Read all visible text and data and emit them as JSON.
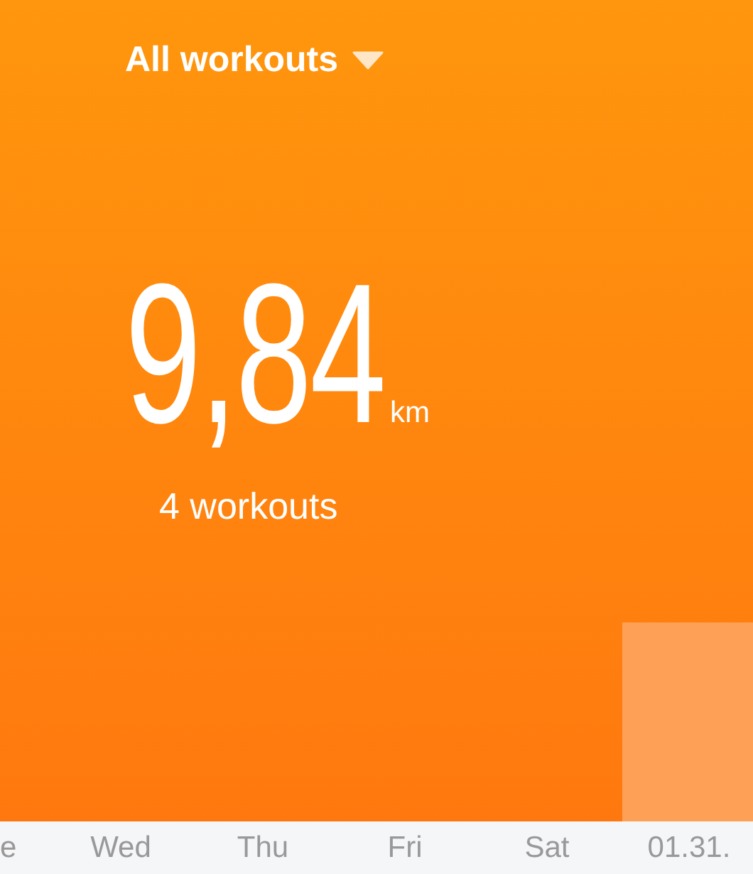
{
  "filter": {
    "label": "All workouts"
  },
  "summary": {
    "distance": "9,84",
    "unit": "km",
    "count": "4 workouts"
  },
  "days": [
    "e",
    "Wed",
    "Thu",
    "Fri",
    "Sat",
    "01.31."
  ]
}
